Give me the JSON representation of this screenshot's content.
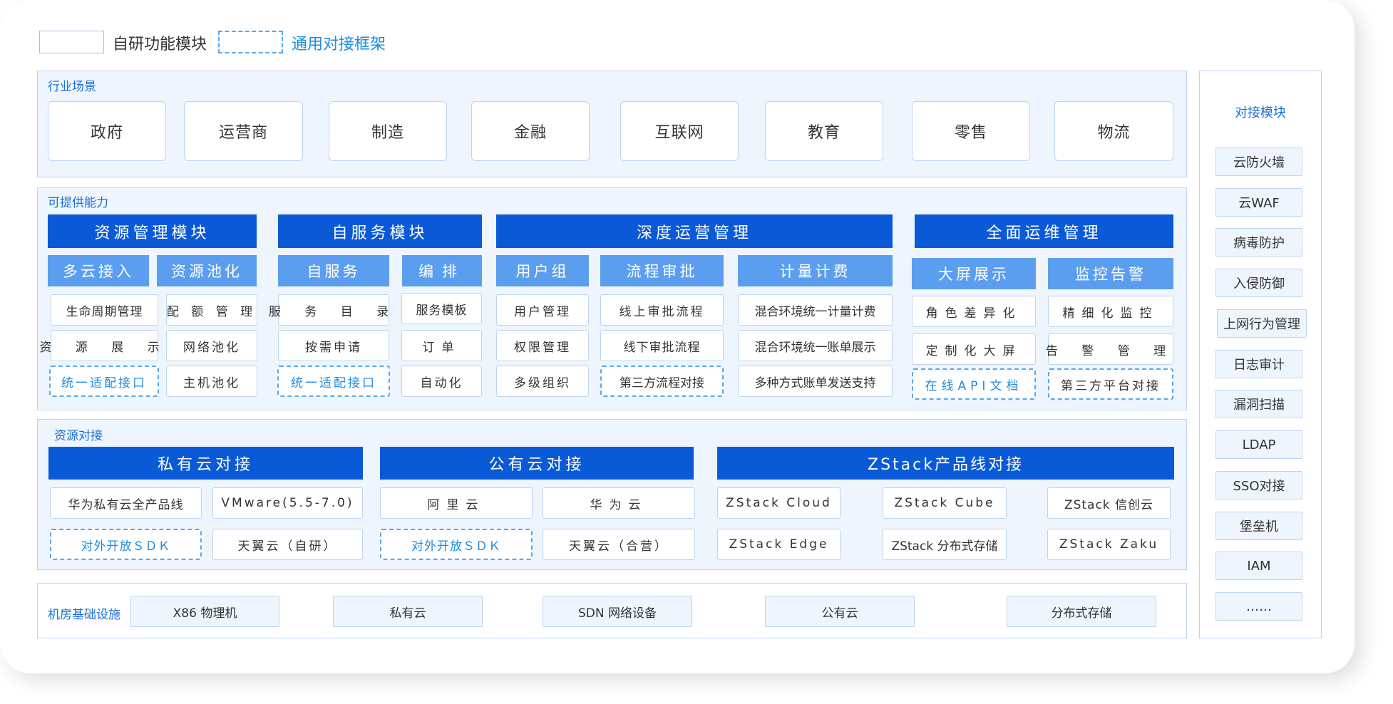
{
  "legend": {
    "own_label": "自研功能模块",
    "framework_label": "通用对接框架"
  },
  "industry": {
    "title": "行业场景",
    "items": [
      "政府",
      "运营商",
      "制造",
      "金融",
      "互联网",
      "教育",
      "零售",
      "物流"
    ]
  },
  "capability": {
    "title": "可提供能力",
    "resource": {
      "head": "资源管理模块",
      "subs": [
        "多云接入",
        "资源池化"
      ],
      "col1": [
        "生命周期管理",
        "资 源 展 示",
        "统一适配接口"
      ],
      "col2": [
        "配 额 管 理",
        "网络池化",
        "主机池化"
      ]
    },
    "selfservice": {
      "head": "自服务模块",
      "subs": [
        "自服务",
        "编排"
      ],
      "col1": [
        "服 务 目 录",
        "按需申请",
        "统一适配接口"
      ],
      "col2": [
        "服务模板",
        "订单",
        "自动化"
      ]
    },
    "ops": {
      "head": "深度运营管理",
      "subs": [
        "用户组",
        "流程审批",
        "计量计费"
      ],
      "col1": [
        "用户管理",
        "权限管理",
        "多级组织"
      ],
      "col2": [
        "线上审批流程",
        "线下审批流程",
        "第三方流程对接"
      ],
      "col3": [
        "混合环境统一计量计费",
        "混合环境统一账单展示",
        "多种方式账单发送支持"
      ]
    },
    "maintenance": {
      "head": "全面运维管理",
      "subs": [
        "大屏展示",
        "监控告警"
      ],
      "col1": [
        "角色差异化",
        "定制化大屏",
        "在线API文档"
      ],
      "col2": [
        "精细化监控",
        "告 警 管 理",
        "第三方平台对接"
      ]
    }
  },
  "resource_link": {
    "title": "资源对接",
    "private": {
      "head": "私有云对接",
      "cells": [
        "华为私有云全产品线",
        "VMware(5.5-7.0)",
        "对外开放ＳＤＫ",
        "天翼云（自研）"
      ]
    },
    "public": {
      "head": "公有云对接",
      "cells": [
        "阿里云",
        "华为云",
        "对外开放ＳＤＫ",
        "天翼云（合营）"
      ]
    },
    "zstack": {
      "head": "ZStack产品线对接",
      "cells": [
        "ZStack Cloud",
        "ZStack Cube",
        "ZStack 信创云",
        "ZStack Edge",
        "ZStack 分布式存储",
        "ZStack Zaku"
      ]
    }
  },
  "infra": {
    "title": "机房基础设施",
    "items": [
      "X86 物理机",
      "私有云",
      "SDN 网络设备",
      "公有云",
      "分布式存储"
    ]
  },
  "side": {
    "title": "对接模块",
    "items": [
      "云防火墙",
      "云WAF",
      "病毒防护",
      "入侵防御",
      "上网行为管理",
      "日志审计",
      "漏洞扫描",
      "LDAP",
      "SSO对接",
      "堡垒机",
      "IAM",
      "……"
    ]
  },
  "colors": {
    "primary_blue": "#0a5ad8",
    "secondary_blue": "#5b9ef0",
    "panel_bg": "#eef5fd",
    "panel_border": "#bcd5f1",
    "dashed_border": "#56a9ea",
    "title_blue": "#1a6fd6"
  }
}
